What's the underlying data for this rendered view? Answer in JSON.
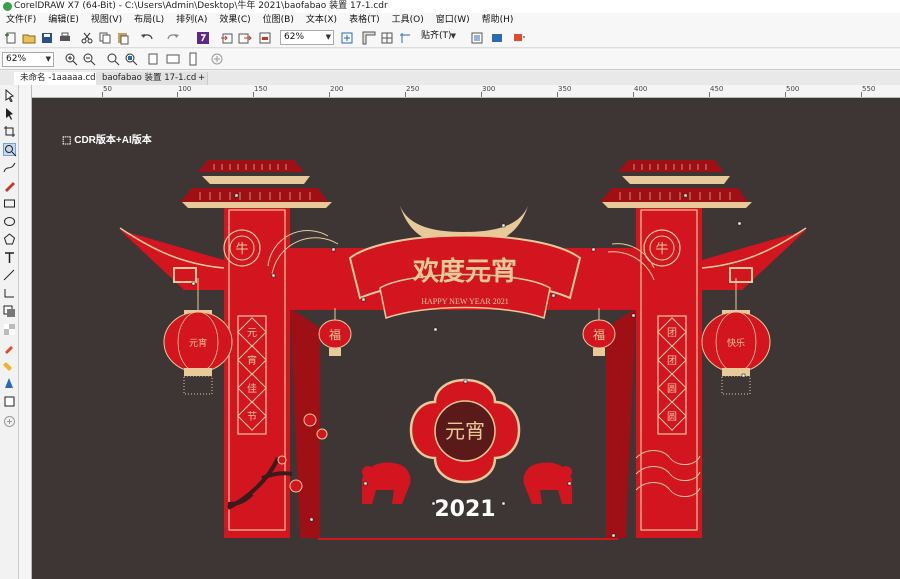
{
  "window": {
    "title": "CorelDRAW X7 (64-Bit) - C:\\Users\\Admin\\Desktop\\牛年 2021\\baofabao 装置 17-1.cdr"
  },
  "menu": [
    "文件(F)",
    "编辑(E)",
    "视图(V)",
    "布局(L)",
    "排列(A)",
    "效果(C)",
    "位图(B)",
    "文本(X)",
    "表格(T)",
    "工具(O)",
    "窗口(W)",
    "帮助(H)"
  ],
  "toolbar": {
    "zoom_value": "62%",
    "snap_label": "贴齐(T)",
    "zoom_value2": "62%"
  },
  "tabs": [
    {
      "label": "未命名 -1aaaaa.cdr"
    },
    {
      "label": "baofabao 装置 17-1.cdr"
    }
  ],
  "ruler": {
    "labels": [
      "50",
      "100",
      "150",
      "200",
      "250",
      "300",
      "350",
      "400",
      "450",
      "500",
      "550"
    ]
  },
  "canvas": {
    "note": "CDR版本+AI版本"
  },
  "artwork": {
    "arch_title": "欢度元宵",
    "banner_text": "HAPPY NEW YEAR 2021",
    "left_couplet": [
      "元",
      "宵",
      "佳",
      "节"
    ],
    "right_couplet": [
      "团",
      "团",
      "圆",
      "圆"
    ],
    "fu": "福",
    "center_text": "元宵",
    "year": "2021",
    "lantern_left": "元宵",
    "lantern_right": "快乐",
    "pillar_char": "牛",
    "colors": {
      "canvas_bg": "#3d3635",
      "red": "#d2151e",
      "dark_red": "#9e0f16",
      "gold": "#e8c99a"
    }
  }
}
